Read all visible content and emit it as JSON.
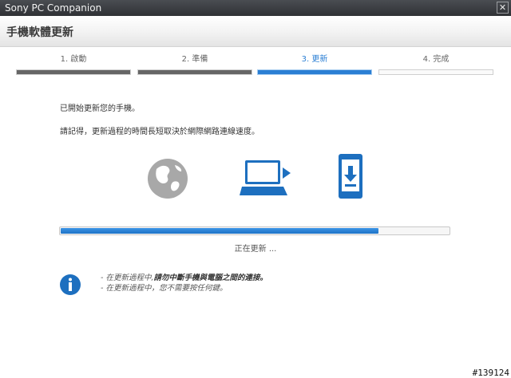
{
  "window": {
    "title": "Sony PC Companion",
    "close_glyph": "✕"
  },
  "header": {
    "title": "手機軟體更新"
  },
  "steps": [
    {
      "label": "1. 啟動",
      "state": "done"
    },
    {
      "label": "2. 準備",
      "state": "done"
    },
    {
      "label": "3. 更新",
      "state": "active"
    },
    {
      "label": "4. 完成",
      "state": "pending"
    }
  ],
  "messages": {
    "started": "已開始更新您的手機。",
    "remember": "請記得，更新過程的時間長短取決於網際網路連線速度。"
  },
  "icons": [
    "globe-icon",
    "laptop-icon",
    "phone-download-icon"
  ],
  "progress": {
    "percent": 82,
    "status": "正在更新 ..."
  },
  "notes": {
    "prefix1": "- 在更新過程中,",
    "emphasis1": "請勿中斷手機與電腦之間的連接。",
    "line2": "- 在更新過程中，您不需要按任何鍵。"
  },
  "watermark": "#139124",
  "colors": {
    "accent": "#2b7fd4",
    "dark_bar": "#666666",
    "globe": "#a8a8a8",
    "icon_blue": "#1d6fbf"
  }
}
